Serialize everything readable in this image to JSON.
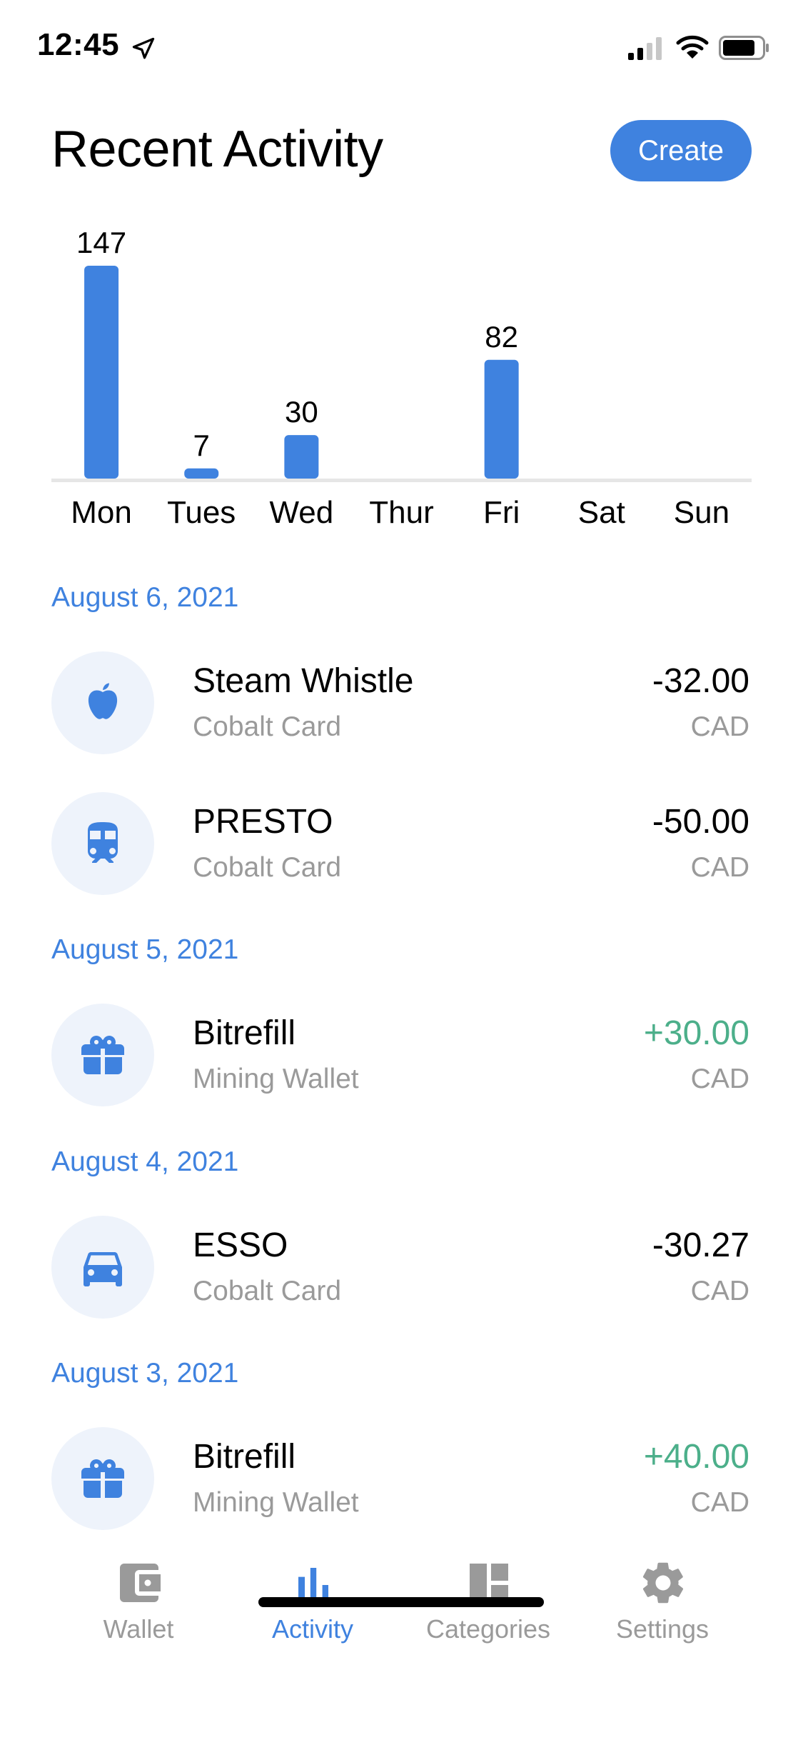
{
  "status_bar": {
    "time": "12:45"
  },
  "header": {
    "title": "Recent Activity",
    "create_label": "Create"
  },
  "chart_data": {
    "type": "bar",
    "categories": [
      "Mon",
      "Tues",
      "Wed",
      "Thur",
      "Fri",
      "Sat",
      "Sun"
    ],
    "values": [
      147,
      7,
      30,
      0,
      82,
      0,
      0
    ],
    "labels": [
      "147",
      "7",
      "30",
      "",
      "82",
      "",
      ""
    ],
    "ylim": [
      0,
      147
    ],
    "color": "#3f82df",
    "grid": false
  },
  "transactions": {
    "groups": [
      {
        "date": "August 6, 2021",
        "items": [
          {
            "name": "Steam Whistle",
            "account": "Cobalt Card",
            "amount": "-32.00",
            "currency": "CAD",
            "icon": "apple-icon"
          },
          {
            "name": "PRESTO",
            "account": "Cobalt Card",
            "amount": "-50.00",
            "currency": "CAD",
            "icon": "train-icon"
          }
        ]
      },
      {
        "date": "August 5, 2021",
        "items": [
          {
            "name": "Bitrefill",
            "account": "Mining Wallet",
            "amount": "+30.00",
            "currency": "CAD",
            "icon": "gift-icon"
          }
        ]
      },
      {
        "date": "August 4, 2021",
        "items": [
          {
            "name": "ESSO",
            "account": "Cobalt Card",
            "amount": "-30.27",
            "currency": "CAD",
            "icon": "car-icon"
          }
        ]
      },
      {
        "date": "August 3, 2021",
        "items": [
          {
            "name": "Bitrefill",
            "account": "Mining Wallet",
            "amount": "+40.00",
            "currency": "CAD",
            "icon": "gift-icon"
          }
        ]
      }
    ]
  },
  "tab_bar": {
    "tabs": [
      {
        "label": "Wallet",
        "icon": "wallet-icon"
      },
      {
        "label": "Activity",
        "icon": "bar-chart-icon"
      },
      {
        "label": "Categories",
        "icon": "categories-icon"
      },
      {
        "label": "Settings",
        "icon": "gear-icon"
      }
    ],
    "active": "Activity"
  },
  "colors": {
    "accent": "#3f82df",
    "positive": "#4caf8a",
    "muted": "#9a9a9a",
    "icon_bg": "#eef3fb",
    "inactive_tab": "#9a9a9a"
  }
}
